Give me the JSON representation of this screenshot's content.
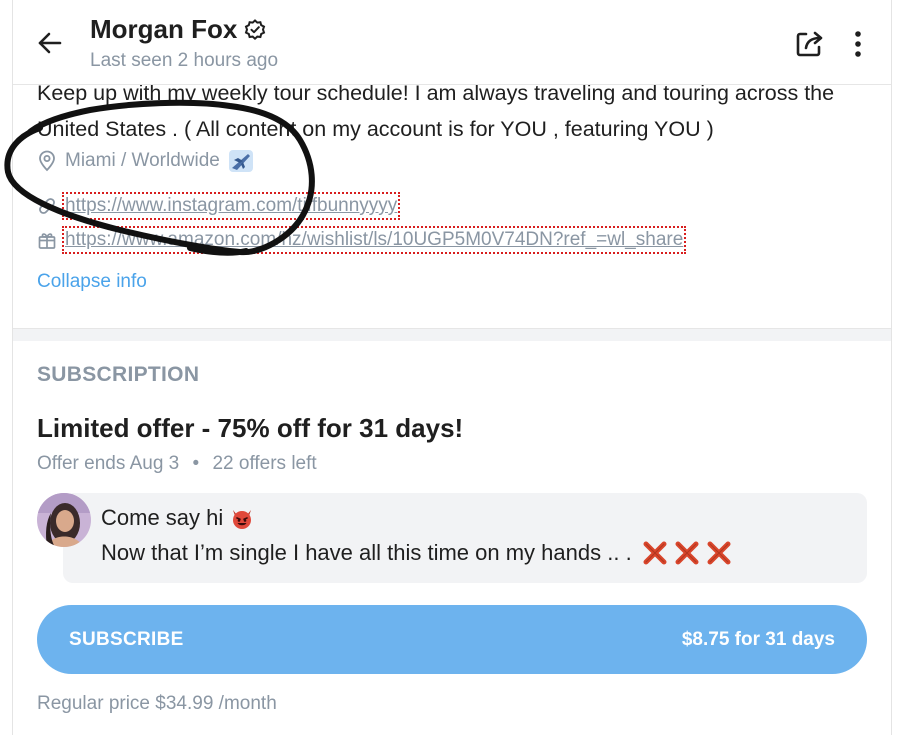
{
  "header": {
    "profile_name": "Morgan Fox",
    "last_seen": "Last seen 2 hours ago"
  },
  "bio": {
    "text": "Keep up with my weekly tour schedule! I am always traveling and touring across the United States . ( All content on my account is for YOU , featuring YOU )",
    "location": "Miami / Worldwide",
    "links": [
      "https://www.instagram.com/tiffbunnyyyy",
      "https://www.amazon.com/hz/wishlist/ls/10UGP5M0V74DN?ref_=wl_share"
    ],
    "collapse_label": "Collapse info"
  },
  "subscription": {
    "section_title": "SUBSCRIPTION",
    "offer_title": "Limited offer - 75% off for 31 days!",
    "offer_ends": "Offer ends Aug 3",
    "offer_separator": "•",
    "offers_left": "22 offers left",
    "message": {
      "line1": "Come say hi",
      "line2": "Now that I’m single I have all this time on my hands .. ."
    },
    "subscribe_label": "SUBSCRIBE",
    "subscribe_price": "$8.75 for 31 days",
    "regular_price": "Regular price $34.99 /month"
  },
  "icons": {
    "back": "arrow-left-icon",
    "verified": "verified-badge-icon",
    "share": "share-icon",
    "more": "more-vertical-icon",
    "location": "location-pin-icon",
    "link": "link-icon",
    "gift": "gift-icon",
    "plane": "airplane-emoji-icon",
    "devil": "smiling-devil-emoji-icon",
    "cross": "cross-mark-emoji-icon"
  },
  "colors": {
    "accent": "#4aa3ea",
    "subscribe_button": "#6db3ee",
    "muted_text": "#8a96a3",
    "annotation": "#d81e1e"
  }
}
